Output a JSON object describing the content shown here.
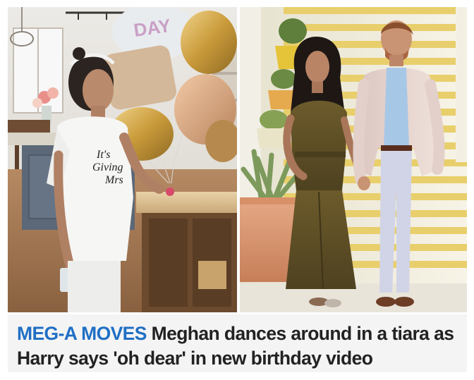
{
  "article": {
    "kicker": "MEG-A MOVES",
    "headline": "Meghan dances around in a tiara as Harry says 'oh dear' in new birthday video"
  },
  "colors": {
    "kicker": "#1f6fc5",
    "headline_text": "#222222",
    "caption_bg": "#f4f4f4"
  },
  "images": {
    "left": {
      "balloon_lettering": "DAY",
      "shirt_lettering": "It's Giving Mrs"
    },
    "right": {}
  }
}
